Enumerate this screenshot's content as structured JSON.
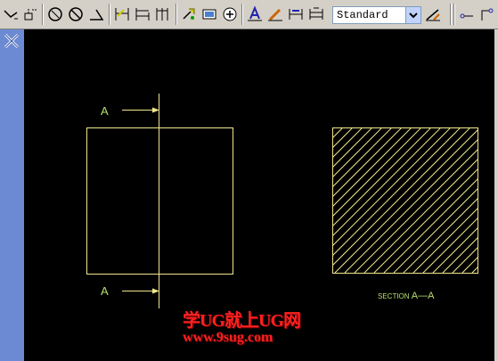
{
  "toolbar": {
    "style_dropdown": {
      "selected": "Standard"
    },
    "icons": [
      "dimension-leader-icon",
      "datum-icon",
      "circle-dim-icon",
      "angle-dim-icon",
      "triangle-dim-icon",
      "baseline-dim-icon",
      "continue-dim-icon",
      "ordinate-dim-icon",
      "tolerance-icon",
      "center-mark-icon",
      "plus-center-icon",
      "text-style-icon",
      "edit-dim-icon",
      "dim-update-icon",
      "dim-override-icon",
      "style-tool-icon",
      "link-icon",
      "leader-end-icon"
    ]
  },
  "drawing": {
    "cut_label_top": "A",
    "cut_label_bottom": "A",
    "section_caption_small": "SECTION",
    "section_caption_big": "A—A",
    "line_color": "#f0e68c",
    "label_color": "#b5e06a",
    "background": "#000000"
  },
  "watermark": {
    "line1": "学UG就上UG网",
    "line2": "www.9sug.com",
    "color": "#ff2020"
  }
}
